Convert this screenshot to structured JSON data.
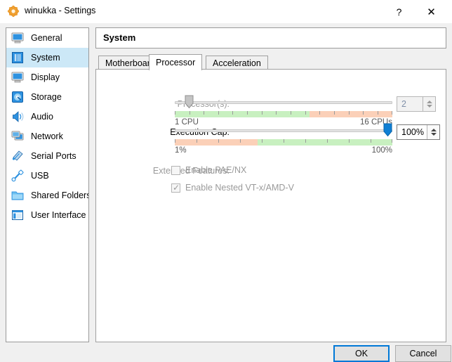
{
  "window": {
    "title": "winukka - Settings",
    "icon": "virtualbox-icon",
    "help_label": "?",
    "close_label": "✕"
  },
  "sidebar": {
    "items": [
      {
        "label": "General",
        "icon": "monitor-icon",
        "selected": false
      },
      {
        "label": "System",
        "icon": "chip-icon",
        "selected": true
      },
      {
        "label": "Display",
        "icon": "display-icon",
        "selected": false
      },
      {
        "label": "Storage",
        "icon": "harddisk-icon",
        "selected": false
      },
      {
        "label": "Audio",
        "icon": "speaker-icon",
        "selected": false
      },
      {
        "label": "Network",
        "icon": "network-icon",
        "selected": false
      },
      {
        "label": "Serial Ports",
        "icon": "serial-port-icon",
        "selected": false
      },
      {
        "label": "USB",
        "icon": "usb-icon",
        "selected": false
      },
      {
        "label": "Shared Folders",
        "icon": "folder-icon",
        "selected": false
      },
      {
        "label": "User Interface",
        "icon": "user-interface-icon",
        "selected": false
      }
    ]
  },
  "header": {
    "title": "System"
  },
  "tabs": [
    {
      "label": "Motherboard",
      "active": false
    },
    {
      "label": "Processor",
      "active": true
    },
    {
      "label": "Acceleration",
      "active": false
    }
  ],
  "processor_tab": {
    "processors": {
      "label": "Processor(s):",
      "value": "2",
      "min_label": "1 CPU",
      "max_label": "16 CPUs",
      "enabled": false,
      "handle_percent": 6,
      "green_percent": 62
    },
    "execution_cap": {
      "label": "Execution Cap:",
      "value": "100%",
      "min_label": "1%",
      "max_label": "100%",
      "enabled": true,
      "handle_percent": 100,
      "salmon_percent": 38
    },
    "extended_features": {
      "label": "Extended Features:",
      "options": [
        {
          "label": "Enable PAE/NX",
          "checked": false,
          "enabled": false
        },
        {
          "label": "Enable Nested VT-x/AMD-V",
          "checked": true,
          "enabled": false
        }
      ]
    }
  },
  "footer": {
    "ok_label": "OK",
    "cancel_label": "Cancel"
  },
  "colors": {
    "accent": "#0078d7",
    "selection": "#cce8f7",
    "tick_green": "#c8f0c0",
    "tick_salmon": "#fbd0b8",
    "dialog_bg": "#f0f0f0"
  }
}
